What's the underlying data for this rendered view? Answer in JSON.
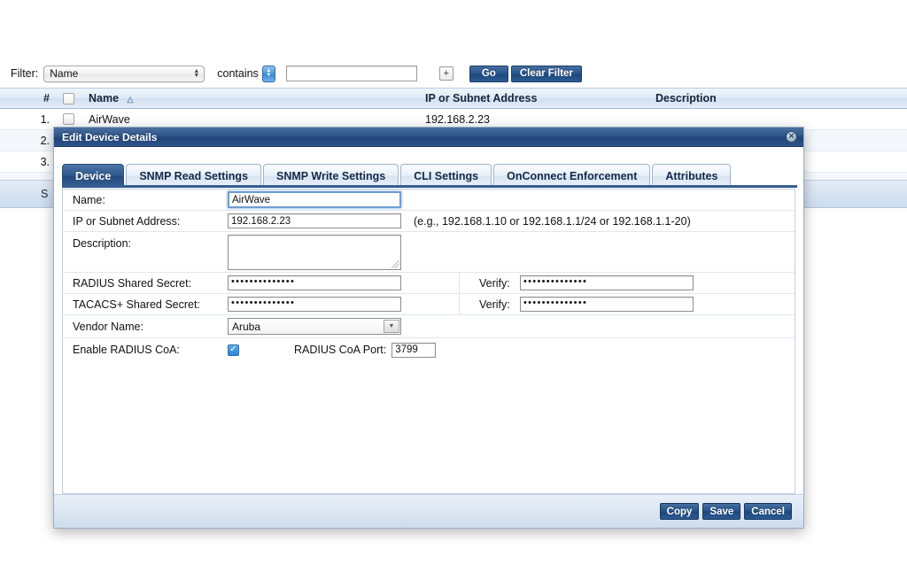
{
  "filter_bar": {
    "label": "Filter:",
    "field_select_value": "Name",
    "operator_value": "contains",
    "value_input": "",
    "value_placeholder": "",
    "add_button_label": "+",
    "go_label": "Go",
    "clear_label": "Clear Filter"
  },
  "table": {
    "columns": [
      "#",
      "",
      "Name",
      "IP or Subnet Address",
      "Description"
    ],
    "sort_column": "Name",
    "sort_direction": "△",
    "rows": [
      {
        "num": "1.",
        "name": "AirWave",
        "ip": "192.168.2.23",
        "description": ""
      },
      {
        "num": "2.",
        "name": "",
        "ip": "",
        "description": ""
      },
      {
        "num": "3.",
        "name": "",
        "ip": "",
        "description": ""
      }
    ],
    "footer_text": "S"
  },
  "modal": {
    "title": "Edit Device Details",
    "close_label": "×",
    "tabs": [
      {
        "label": "Device",
        "active": true
      },
      {
        "label": "SNMP Read Settings",
        "active": false
      },
      {
        "label": "SNMP Write Settings",
        "active": false
      },
      {
        "label": "CLI Settings",
        "active": false
      },
      {
        "label": "OnConnect Enforcement",
        "active": false
      },
      {
        "label": "Attributes",
        "active": false
      }
    ],
    "form": {
      "name_label": "Name:",
      "name_value": "AirWave",
      "ip_label": "IP or Subnet Address:",
      "ip_value": "192.168.2.23",
      "ip_hint": "(e.g., 192.168.1.10 or 192.168.1.1/24 or 192.168.1.1-20)",
      "description_label": "Description:",
      "description_value": "",
      "radius_secret_label": "RADIUS Shared Secret:",
      "radius_secret_value": "••••••••••••••",
      "radius_verify_label": "Verify:",
      "radius_verify_value": "••••••••••••••",
      "tacacs_secret_label": "TACACS+ Shared Secret:",
      "tacacs_secret_value": "••••••••••••••",
      "tacacs_verify_label": "Verify:",
      "tacacs_verify_value": "••••••••••••••",
      "vendor_label": "Vendor Name:",
      "vendor_value": "Aruba",
      "coa_label": "Enable RADIUS CoA:",
      "coa_checked": true,
      "coa_port_label": "RADIUS CoA Port:",
      "coa_port_value": "3799"
    },
    "buttons": {
      "copy": "Copy",
      "save": "Save",
      "cancel": "Cancel"
    }
  },
  "colors": {
    "title_bar": "#2d5589",
    "accent_blue": "#24528c",
    "tab_active": "#2f5a90",
    "checkbox_on": "#2e86d6",
    "header_row": "#dfeaf6"
  }
}
